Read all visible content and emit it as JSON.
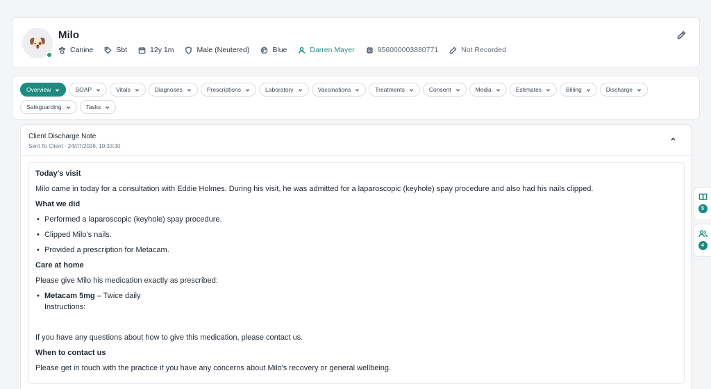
{
  "patient": {
    "name": "Milo",
    "avatar_icon": "dog-avatar-icon",
    "status_color": "#22a06b",
    "species": "Canine",
    "breed": "Sbt",
    "age": "12y 1m",
    "sex": "Male (Neutered)",
    "color": "Blue",
    "owner": "Darren Mayer",
    "microchip": "956000003880771",
    "insurance": "Not Recorded"
  },
  "tabs": [
    {
      "label": "Overview",
      "active": true
    },
    {
      "label": "SOAP"
    },
    {
      "label": "Vitals"
    },
    {
      "label": "Diagnoses"
    },
    {
      "label": "Prescriptions"
    },
    {
      "label": "Laboratory"
    },
    {
      "label": "Vaccinations"
    },
    {
      "label": "Treatments"
    },
    {
      "label": "Consent"
    },
    {
      "label": "Media"
    },
    {
      "label": "Estimates"
    },
    {
      "label": "Billing"
    },
    {
      "label": "Discharge"
    },
    {
      "label": "Safeguarding"
    },
    {
      "label": "Tasks"
    }
  ],
  "note": {
    "title": "Client Discharge Note",
    "subtitle": "Sent To Client · 24/07/2026, 10:33:30",
    "sections": {
      "visit_heading": "Today's visit",
      "visit_text": "Milo came in today for a consultation with Eddie Holmes. During his visit, he was admitted for a laparoscopic (keyhole) spay procedure and also had his nails clipped.",
      "did_heading": "What we did",
      "did_items": [
        "Performed a laparoscopic (keyhole) spay procedure.",
        "Clipped Milo's nails.",
        "Provided a prescription for Metacam."
      ],
      "care_heading": "Care at home",
      "care_text": "Please give Milo his medication exactly as prescribed:",
      "med_name": "Metacam 5mg",
      "med_freq": " – Twice daily",
      "med_instructions": "Instructions:",
      "questions_text": "If you have any questions about how to give this medication, please contact us.",
      "contact_heading": "When to contact us",
      "contact_text": "Please get in touch with the practice if you have any concerns about Milo's recovery or general wellbeing."
    }
  },
  "side_tabs": [
    {
      "icon": "book-icon",
      "count": "5"
    },
    {
      "icon": "users-icon",
      "count": "4"
    }
  ],
  "accent_color": "#1d8b82"
}
